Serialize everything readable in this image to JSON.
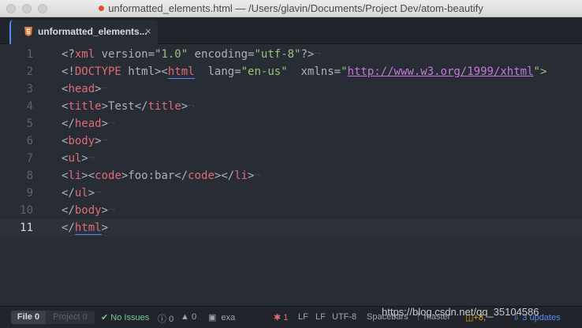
{
  "window": {
    "title": "unformatted_elements.html — /Users/glavin/Documents/Project Dev/atom-beautify"
  },
  "tabs": [
    {
      "label": "unformatted_elements...",
      "icon": "html5-icon",
      "close": "×"
    }
  ],
  "editor": {
    "current_line": 11,
    "line_numbers": [
      "1",
      "2",
      "3",
      "4",
      "5",
      "6",
      "7",
      "8",
      "9",
      "10",
      "11"
    ],
    "invisible_eol": "¬",
    "lines": [
      {
        "tokens": [
          "<?",
          "xml",
          " version=",
          "\"1.0\"",
          " encoding=",
          "\"utf-8\"",
          "?>"
        ]
      },
      {
        "tokens": [
          "<!",
          "DOCTYPE",
          " html><",
          "html",
          "  lang=",
          "\"en-us\"",
          "  xmlns=",
          "\"",
          "http://www.w3.org/1999/xhtml",
          "\">"
        ]
      },
      {
        "tokens": [
          "<",
          "head",
          ">"
        ]
      },
      {
        "tokens": [
          "<",
          "title",
          ">Test</",
          "title",
          ">"
        ]
      },
      {
        "tokens": [
          "</",
          "head",
          ">"
        ]
      },
      {
        "tokens": [
          "<",
          "body",
          ">"
        ]
      },
      {
        "tokens": [
          "<",
          "ul",
          ">"
        ]
      },
      {
        "tokens": [
          "<",
          "li",
          "><",
          "code",
          ">foo:bar</",
          "code",
          "></",
          "li",
          ">"
        ]
      },
      {
        "tokens": [
          "</",
          "ul",
          ">"
        ]
      },
      {
        "tokens": [
          "</",
          "body",
          ">"
        ]
      },
      {
        "tokens": [
          "</",
          "html",
          ">"
        ]
      }
    ]
  },
  "statusbar": {
    "file_label": "File",
    "file_count": "0",
    "project_label": "Project",
    "project_count": "0",
    "issues": "No Issues",
    "info_count": "0",
    "warning_count": "0",
    "terminal_label": "exa",
    "bug_count": "1",
    "line_ending_1": "LF",
    "line_ending_2": "LF",
    "encoding": "UTF-8",
    "indent": "Spacebars",
    "branch": "master",
    "git_changes": "+8,",
    "updates": "3 updates"
  },
  "watermark": "https://blog.csdn.net/qq_35104586",
  "colors": {
    "background": "#282c34",
    "tag": "#e06c75",
    "string": "#98c379",
    "attribute": "#d19a66",
    "link": "#c678dd",
    "accent": "#568af2"
  }
}
